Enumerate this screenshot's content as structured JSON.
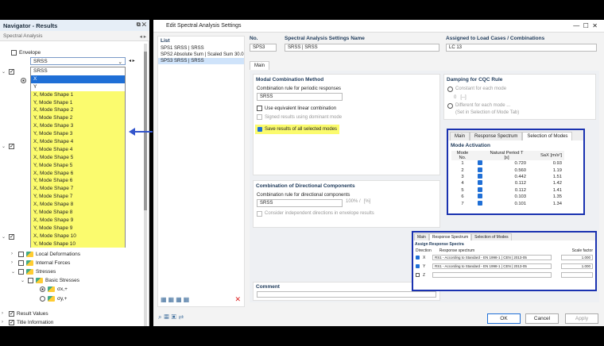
{
  "nav": {
    "title": "Navigator - Results",
    "subtitle": "Spectral Analysis",
    "envelope": "Envelope",
    "dd_value": "SRSS",
    "dd_items": [
      "SRSS",
      "X",
      "Y",
      "X, Mode Shape 1",
      "Y, Mode Shape 1",
      "X, Mode Shape 2",
      "Y, Mode Shape 2",
      "X, Mode Shape 3",
      "Y, Mode Shape 3",
      "X, Mode Shape 4",
      "Y, Mode Shape 4",
      "X, Mode Shape 5",
      "Y, Mode Shape 5",
      "X, Mode Shape 6",
      "Y, Mode Shape 6",
      "X, Mode Shape 7",
      "Y, Mode Shape 7",
      "X, Mode Shape 8",
      "Y, Mode Shape 8",
      "X, Mode Shape 9",
      "Y, Mode Shape 9",
      "X, Mode Shape 10",
      "Y, Mode Shape 10"
    ],
    "tree": {
      "local_def": "Local Deformations",
      "internal_forces": "Internal Forces",
      "stresses": "Stresses",
      "basic_stresses": "Basic Stresses",
      "sx": "σx,+",
      "sy": "σy,+",
      "result_values": "Result Values",
      "title_info": "Title Information"
    }
  },
  "dialog": {
    "title": "Edit Spectral Analysis Settings",
    "list_label": "List",
    "list": [
      "SPS1 SRSS | SRSS",
      "SPS2 Absolute Sum | Scaled Sum 30.0",
      "SPS3 SRSS | SRSS"
    ],
    "no_label": "No.",
    "no_value": "SPS3",
    "name_label": "Spectral Analysis Settings Name",
    "name_value": "SRSS | SRSS",
    "assigned_label": "Assigned to Load Cases / Combinations",
    "assigned_value": "LC 13",
    "tab_main": "Main",
    "modal": {
      "title": "Modal Combination Method",
      "rule_label": "Combination rule for periodic responses",
      "rule_value": "SRSS",
      "equiv": "Use equivalent linear combination",
      "signed": "Signed results using dominant mode",
      "save": "Save results of all selected modes"
    },
    "damping": {
      "title": "Damping for CQC Rule",
      "constant": "Constant for each mode",
      "val": "0",
      "unit": "[--]",
      "different": "Different for each mode ...",
      "different_note": "(Set in Selection of Mode Tab)"
    },
    "directional": {
      "title": "Combination of Directional Components",
      "rule_label": "Combination rule for directional components",
      "rule_value": "SRSS",
      "pct": "100% /",
      "unit": "[%]",
      "consider": "Consider independent directions in envelope results"
    },
    "comment": "Comment",
    "modes_tabs": [
      "Main",
      "Response Spectrum",
      "Selection of Modes"
    ],
    "mode_activation": "Mode Activation",
    "mode_header": {
      "no": "Mode No.",
      "period": "Natural Period T [s]",
      "sa": "SaX [m/s²]"
    },
    "modes": [
      [
        "1",
        "0.720",
        "0.93"
      ],
      [
        "2",
        "0.560",
        "1.19"
      ],
      [
        "3",
        "0.442",
        "1.51"
      ],
      [
        "4",
        "0.112",
        "1.42"
      ],
      [
        "5",
        "0.112",
        "1.41"
      ],
      [
        "6",
        "0.103",
        "1.35"
      ],
      [
        "7",
        "0.101",
        "1.34"
      ]
    ],
    "rs": {
      "tabs": [
        "Main",
        "Response Spectrum",
        "Selection of Modes"
      ],
      "title": "Assign Response Spectra",
      "dir": "Direction",
      "rs": "Response spectrum",
      "sf": "Scale factor",
      "rows": [
        [
          "X",
          "RS1 - According to Standard - EN 1998-1 | CEN | 2013-05",
          "1.000"
        ],
        [
          "Y",
          "RS1 - According to Standard - EN 1998-1 | CEN | 2013-05",
          "1.000"
        ],
        [
          "Z",
          "",
          ""
        ]
      ]
    },
    "ok": "OK",
    "cancel": "Cancel",
    "apply": "Apply"
  }
}
